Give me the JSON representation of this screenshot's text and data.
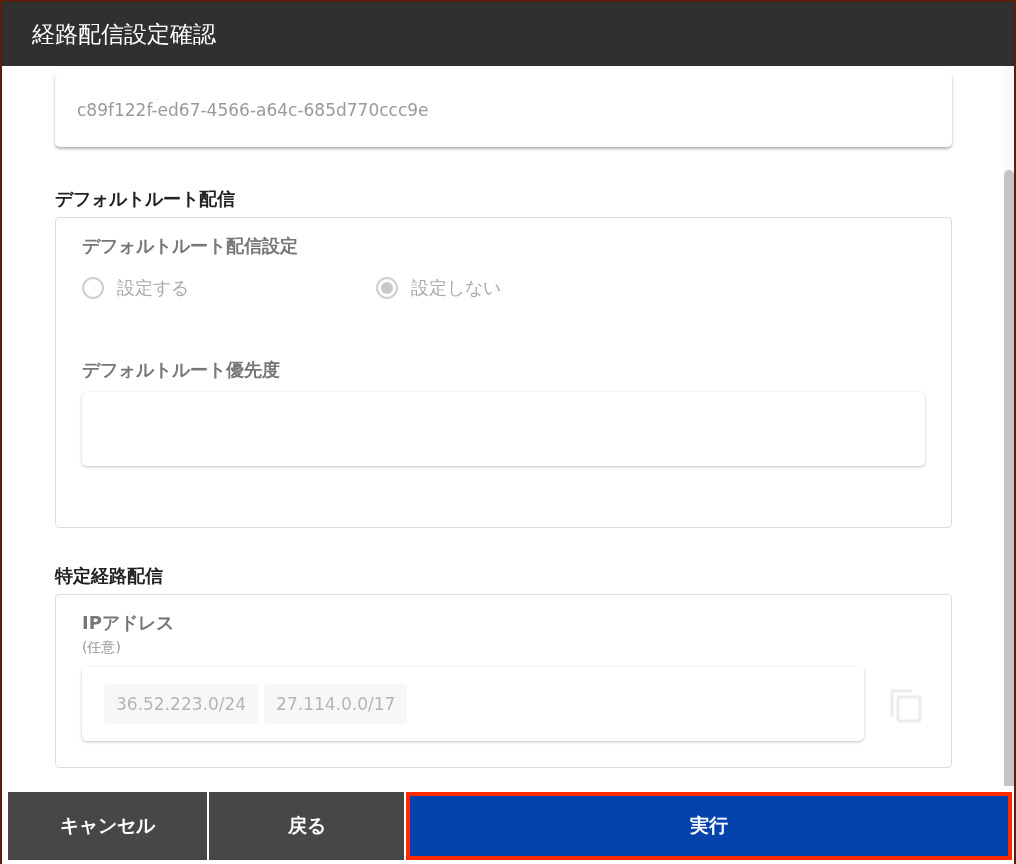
{
  "window": {
    "title": "経路配信設定確認"
  },
  "id_field": {
    "value": "c89f122f-ed67-4566-a64c-685d770ccc9e"
  },
  "default_route": {
    "heading": "デフォルトルート配信",
    "setting_label": "デフォルトルート配信設定",
    "disabled": true,
    "options": [
      {
        "label": "設定する",
        "selected": false
      },
      {
        "label": "設定しない",
        "selected": true
      }
    ],
    "priority_label": "デフォルトルート優先度"
  },
  "specific_route": {
    "heading": "特定経路配信",
    "ip_label": "IPアドレス",
    "ip_note": "(任意)",
    "ip_values": [
      "36.52.223.0/24",
      "27.114.0.0/17"
    ]
  },
  "buttons": [
    {
      "label": "キャンセル",
      "kind": "secondary",
      "highlighted": false
    },
    {
      "label": "戻る",
      "kind": "secondary",
      "highlighted": false
    },
    {
      "label": "実行",
      "kind": "primary",
      "highlighted": true
    }
  ]
}
